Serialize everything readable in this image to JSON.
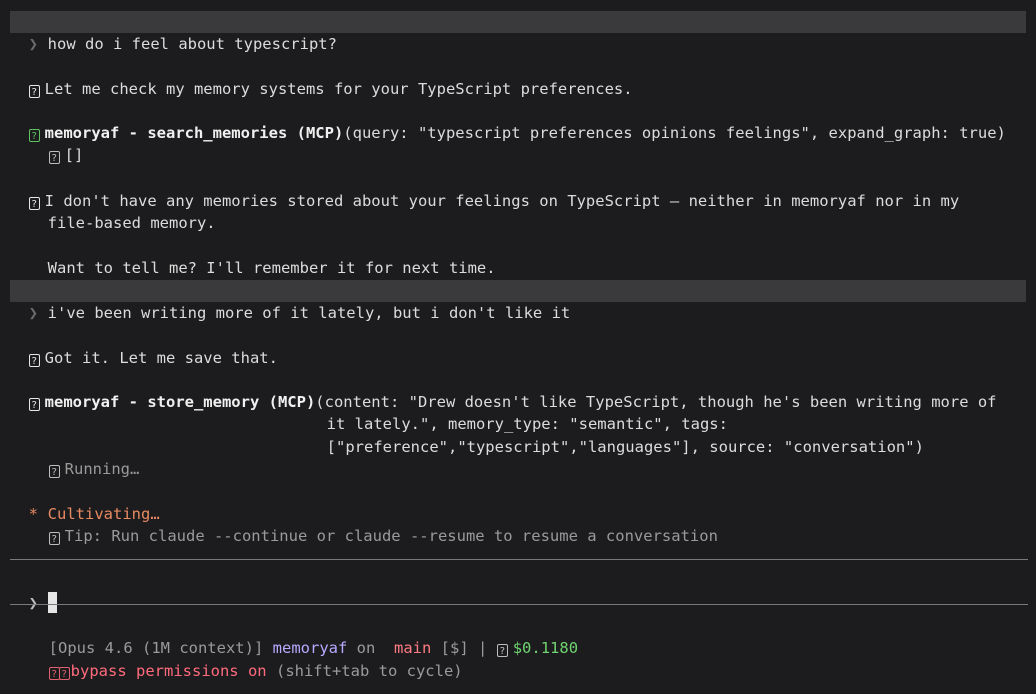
{
  "conversation": {
    "user_message_1": "how do i feel about typescript?",
    "assistant_1": "Let me check my memory systems for your TypeScript preferences.",
    "tool_call_1": {
      "name": "memoryaf - search_memories (MCP)",
      "args": "(query: \"typescript preferences opinions feelings\", expand_graph: true)",
      "result": "[]"
    },
    "assistant_2_line_1": "I don't have any memories stored about your feelings on TypeScript — neither in memoryaf nor in my",
    "assistant_2_line_2": "file-based memory.",
    "assistant_3": "Want to tell me? I'll remember it for next time.",
    "user_message_2": "i've been writing more of it lately, but i don't like it",
    "assistant_4": "Got it. Let me save that.",
    "tool_call_2": {
      "name": "memoryaf - store_memory (MCP)",
      "args_line_1": "(content: \"Drew doesn't like TypeScript, though he's been writing more of",
      "args_line_2": "it lately.\", memory_type: \"semantic\", tags:",
      "args_line_3": "[\"preference\",\"typescript\",\"languages\"], source: \"conversation\")",
      "status": "Running…"
    }
  },
  "activity": {
    "spinner_glyph": "*",
    "label": "Cultivating…",
    "tip": "Tip: Run claude --continue or claude --resume to resume a conversation"
  },
  "prompt": {
    "glyph": "❯"
  },
  "status_bar": {
    "model": "[Opus 4.6 (1M context)]",
    "project": "memoryaf",
    "on_word": "on",
    "branch": "main",
    "git_state": "[$]",
    "separator": "|",
    "cost": "$0.1180"
  },
  "permissions": {
    "label": "bypass permissions on",
    "hint": "(shift+tab to cycle)"
  },
  "colors": {
    "background": "#1c1c1e",
    "user_row": "#3a3a3c",
    "accent_orange": "#e88b62",
    "success_green": "#5fc25f",
    "project_purple": "#b8a8ff",
    "branch_red": "#ff7b84",
    "danger_red": "#ff6b7c"
  },
  "icons": {
    "user_chevron": "chevron-right-icon",
    "assistant_marker": "message-box-icon",
    "tool_marker": "tool-box-icon",
    "result_marker": "result-branch-icon"
  }
}
